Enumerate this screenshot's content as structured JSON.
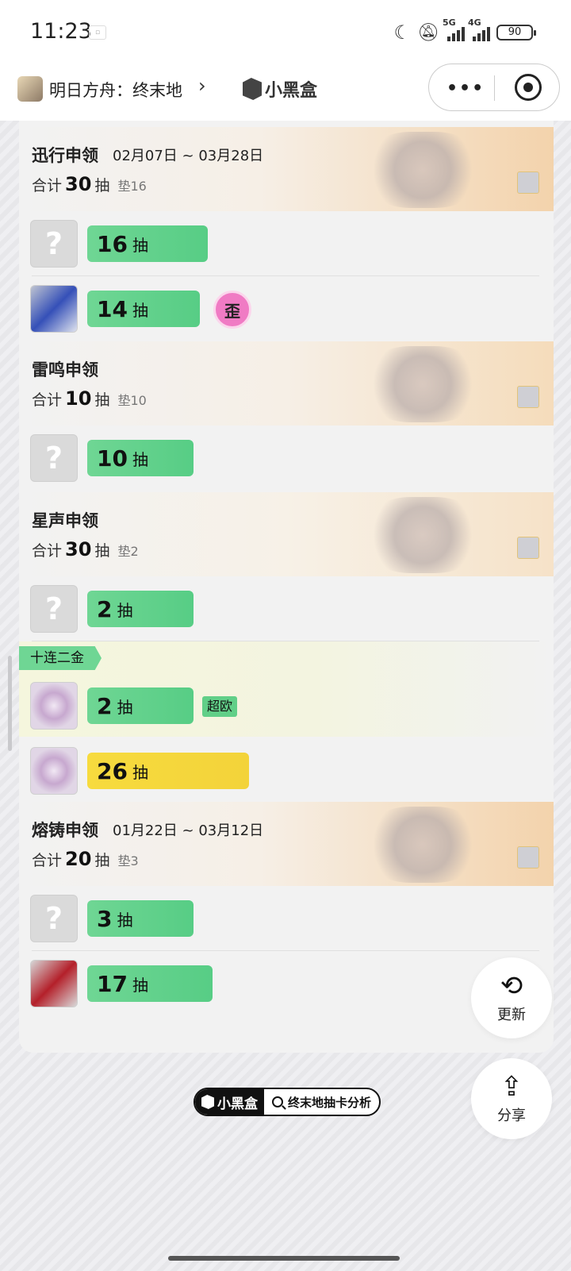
{
  "status_bar": {
    "time": "11:23",
    "net1": "5G",
    "net2": "4G",
    "battery": "90"
  },
  "nav": {
    "app_name": "明日方舟：终末地",
    "brand": "小黑盒"
  },
  "pools": [
    {
      "name": "迅行申领",
      "date": "02月07日 ~ 03月28日",
      "total_label": "合计",
      "total": "30",
      "unit": "抽",
      "pity_label": "垫16"
    },
    {
      "name": "雷鸣申领",
      "date": "",
      "total_label": "合计",
      "total": "10",
      "unit": "抽",
      "pity_label": "垫10"
    },
    {
      "name": "星声申领",
      "date": "",
      "total_label": "合计",
      "total": "30",
      "unit": "抽",
      "pity_label": "垫2"
    },
    {
      "name": "熔铸申领",
      "date": "01月22日 ~ 03月12日",
      "total_label": "合计",
      "total": "20",
      "unit": "抽",
      "pity_label": "垫3"
    }
  ],
  "rows": {
    "r1": {
      "count": "16",
      "unit": "抽",
      "icon": "unknown-icon"
    },
    "r2": {
      "count": "14",
      "unit": "抽",
      "badge": "歪"
    },
    "r3": {
      "count": "10",
      "unit": "抽"
    },
    "r4": {
      "count": "2",
      "unit": "抽"
    },
    "r5": {
      "count": "2",
      "unit": "抽",
      "tag": "超欧"
    },
    "r6": {
      "count": "26",
      "unit": "抽"
    },
    "r7": {
      "count": "3",
      "unit": "抽"
    },
    "r8": {
      "count": "17",
      "unit": "抽"
    }
  },
  "highlight": {
    "ribbon": "十连二金"
  },
  "buttons": {
    "refresh": "更新",
    "share": "分享"
  },
  "footer": {
    "brand": "小黑盒",
    "search_text": "终末地抽卡分析"
  },
  "colors": {
    "green_bar": "#57cd85",
    "gold_bar": "#f3d33a",
    "pink_badge": "#f07bc4"
  }
}
